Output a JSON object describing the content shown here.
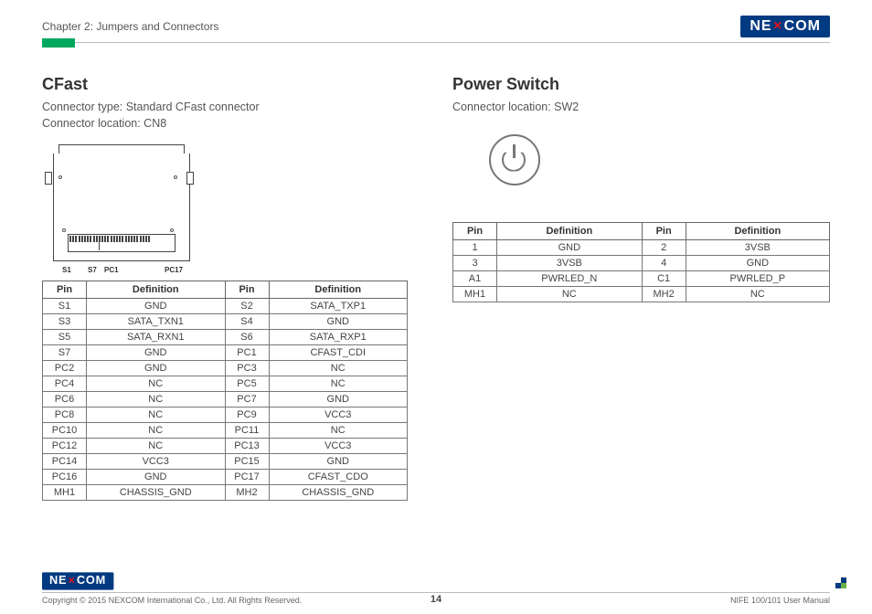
{
  "page": {
    "chapter": "Chapter 2: Jumpers and Connectors",
    "number": "14",
    "copyright": "Copyright © 2015 NEXCOM International Co., Ltd. All Rights Reserved.",
    "manual": "NIFE 100/101 User Manual"
  },
  "logo": {
    "pre": "NE",
    "mark": "✕",
    "post": "COM"
  },
  "cfast": {
    "title": "CFast",
    "meta1": "Connector type: Standard CFast connector",
    "meta2": "Connector location: CN8",
    "labels": {
      "s1": "S1",
      "s7": "S7",
      "pc1": "PC1",
      "pc17": "PC17"
    },
    "headers": [
      "Pin",
      "Definition",
      "Pin",
      "Definition"
    ],
    "rows": [
      [
        "S1",
        "GND",
        "S2",
        "SATA_TXP1"
      ],
      [
        "S3",
        "SATA_TXN1",
        "S4",
        "GND"
      ],
      [
        "S5",
        "SATA_RXN1",
        "S6",
        "SATA_RXP1"
      ],
      [
        "S7",
        "GND",
        "PC1",
        "CFAST_CDI"
      ],
      [
        "PC2",
        "GND",
        "PC3",
        "NC"
      ],
      [
        "PC4",
        "NC",
        "PC5",
        "NC"
      ],
      [
        "PC6",
        "NC",
        "PC7",
        "GND"
      ],
      [
        "PC8",
        "NC",
        "PC9",
        "VCC3"
      ],
      [
        "PC10",
        "NC",
        "PC11",
        "NC"
      ],
      [
        "PC12",
        "NC",
        "PC13",
        "VCC3"
      ],
      [
        "PC14",
        "VCC3",
        "PC15",
        "GND"
      ],
      [
        "PC16",
        "GND",
        "PC17",
        "CFAST_CDO"
      ],
      [
        "MH1",
        "CHASSIS_GND",
        "MH2",
        "CHASSIS_GND"
      ]
    ]
  },
  "power": {
    "title": "Power Switch",
    "meta1": "Connector location: SW2",
    "headers": [
      "Pin",
      "Definition",
      "Pin",
      "Definition"
    ],
    "rows": [
      [
        "1",
        "GND",
        "2",
        "3VSB"
      ],
      [
        "3",
        "3VSB",
        "4",
        "GND"
      ],
      [
        "A1",
        "PWRLED_N",
        "C1",
        "PWRLED_P"
      ],
      [
        "MH1",
        "NC",
        "MH2",
        "NC"
      ]
    ]
  }
}
